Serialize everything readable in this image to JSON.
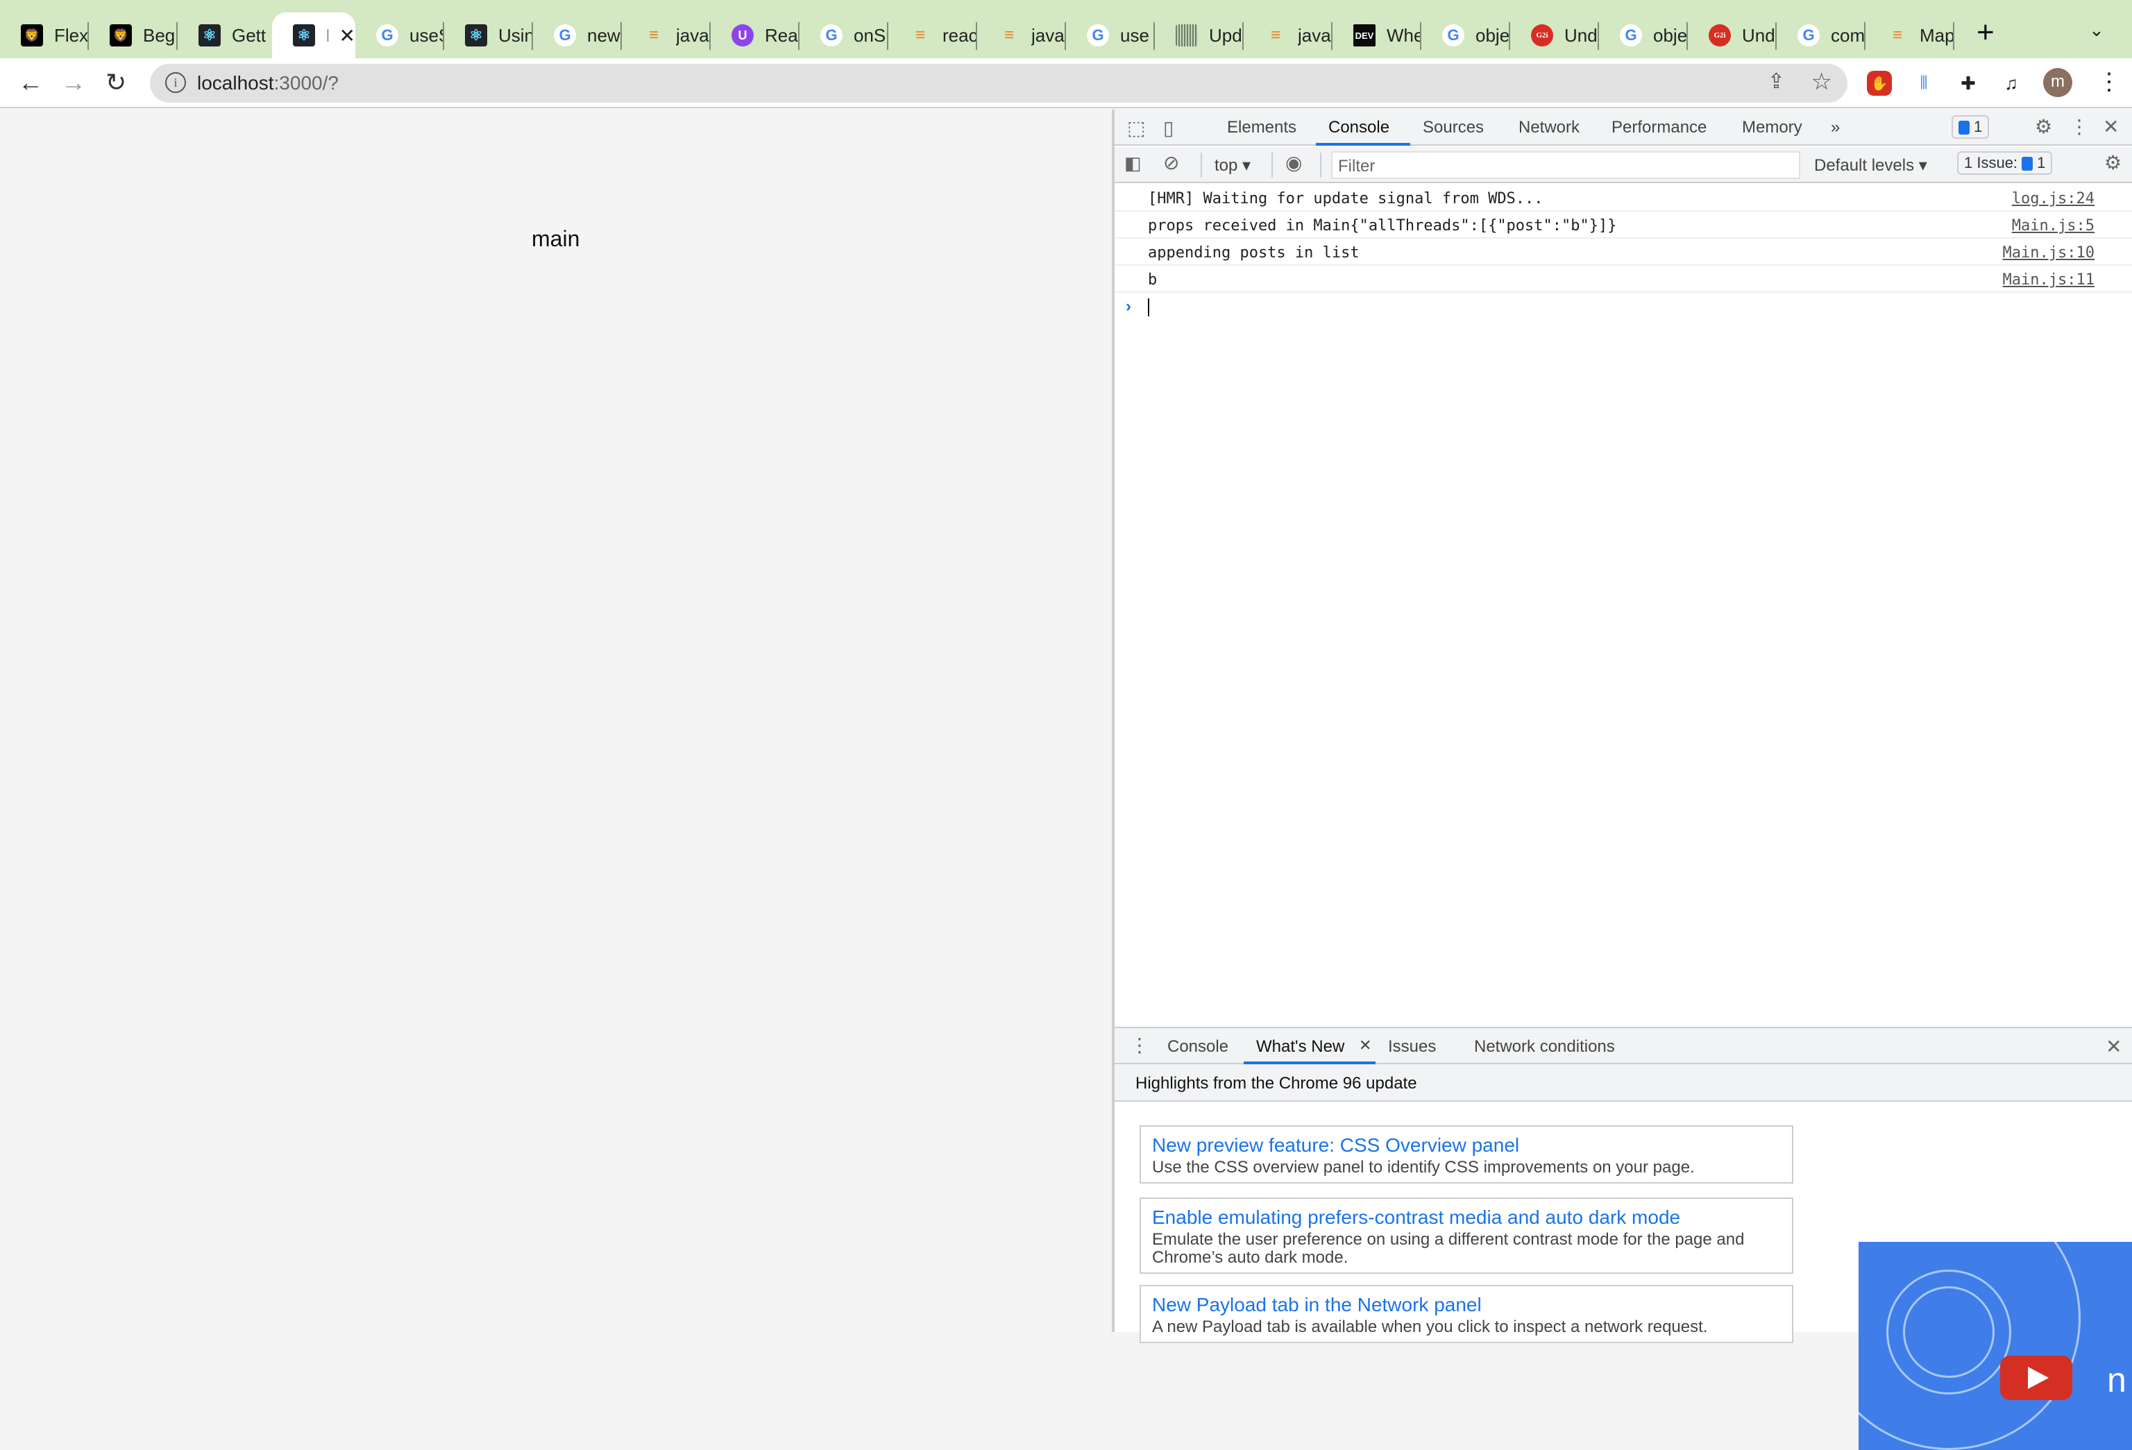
{
  "browser": {
    "tabs": [
      {
        "title": "FlexBox",
        "icon": "lion-icon",
        "fav": "lion",
        "glyph": "🦁"
      },
      {
        "title": "Beginner",
        "icon": "lion-icon",
        "fav": "lion",
        "glyph": "🦁"
      },
      {
        "title": "Getting",
        "icon": "react-icon",
        "fav": "react",
        "glyph": "⚛"
      },
      {
        "title": "R",
        "icon": "react-icon",
        "fav": "react",
        "glyph": "⚛",
        "active": true
      },
      {
        "title": "useState",
        "icon": "google-icon",
        "fav": "g",
        "glyph": "G"
      },
      {
        "title": "Using",
        "icon": "react-icon",
        "fav": "react",
        "glyph": "⚛"
      },
      {
        "title": "new",
        "icon": "google-icon",
        "fav": "g",
        "glyph": "G"
      },
      {
        "title": "javascript",
        "icon": "stackoverflow-icon",
        "fav": "so",
        "glyph": "≡"
      },
      {
        "title": "React",
        "icon": "udemy-icon",
        "fav": "u",
        "glyph": "U"
      },
      {
        "title": "onSubmit",
        "icon": "google-icon",
        "fav": "g",
        "glyph": "G"
      },
      {
        "title": "react",
        "icon": "stackoverflow-icon",
        "fav": "so",
        "glyph": "≡"
      },
      {
        "title": "javascript",
        "icon": "stackoverflow-icon",
        "fav": "so",
        "glyph": "≡"
      },
      {
        "title": "use",
        "icon": "google-icon",
        "fav": "g",
        "glyph": "G"
      },
      {
        "title": "Update",
        "icon": "site-icon",
        "fav": "upd",
        "glyph": ""
      },
      {
        "title": "javascript",
        "icon": "stackoverflow-icon",
        "fav": "so",
        "glyph": "≡"
      },
      {
        "title": "When",
        "icon": "dev-icon",
        "fav": "dev",
        "glyph": "DEV"
      },
      {
        "title": "object",
        "icon": "google-icon",
        "fav": "g",
        "glyph": "G"
      },
      {
        "title": "Under",
        "icon": "g2i-icon",
        "fav": "g2i",
        "glyph": "G2i"
      },
      {
        "title": "object",
        "icon": "google-icon",
        "fav": "g",
        "glyph": "G"
      },
      {
        "title": "Under",
        "icon": "g2i-icon",
        "fav": "g2i",
        "glyph": "G2i"
      },
      {
        "title": "com",
        "icon": "google-icon",
        "fav": "g",
        "glyph": "G"
      },
      {
        "title": "Map",
        "icon": "stackoverflow-icon",
        "fav": "so",
        "glyph": "≡"
      }
    ],
    "new_tab": "+",
    "tab_search": "⌄",
    "url_host": "localhost",
    "url_rest": ":3000/?",
    "avatar_initial": "m"
  },
  "page": {
    "text": "main"
  },
  "devtools": {
    "tabs": [
      "Elements",
      "Console",
      "Sources",
      "Network",
      "Performance",
      "Memory"
    ],
    "active_tab": "Console",
    "more_tabs": "»",
    "messages_badge": "1",
    "context": "top ▾",
    "filter_placeholder": "Filter",
    "levels": "Default levels ▾",
    "issues_label": "1 Issue:",
    "issues_count": "1",
    "logs": [
      {
        "message": "[HMR] Waiting for update signal from WDS...",
        "source": "log.js:24"
      },
      {
        "message": "props received in Main{\"allThreads\":[{\"post\":\"b\"}]}",
        "source": "Main.js:5"
      },
      {
        "message": "appending posts in list",
        "source": "Main.js:10"
      },
      {
        "message": "b",
        "source": "Main.js:11"
      }
    ],
    "prompt_caret": "›",
    "drawer": {
      "tabs": [
        "Console",
        "What's New",
        "Issues",
        "Network conditions"
      ],
      "active_tab": "What's New",
      "highlights": "Highlights from the Chrome 96 update",
      "cards": [
        {
          "title": "New preview feature: CSS Overview panel",
          "desc": "Use the CSS overview panel to identify CSS improvements on your page."
        },
        {
          "title": "Enable emulating prefers-contrast media and auto dark mode",
          "desc": "Emulate the user preference on using a different contrast mode for the page and Chrome’s auto dark mode."
        },
        {
          "title": "New Payload tab in the Network panel",
          "desc": "A new Payload tab is available when you click to inspect a network request."
        }
      ],
      "video_text": "n"
    }
  },
  "colors": {
    "tabstrip": "#d3e8c3",
    "accent": "#1a73e8",
    "devtools_bg": "#f1f3f4"
  }
}
